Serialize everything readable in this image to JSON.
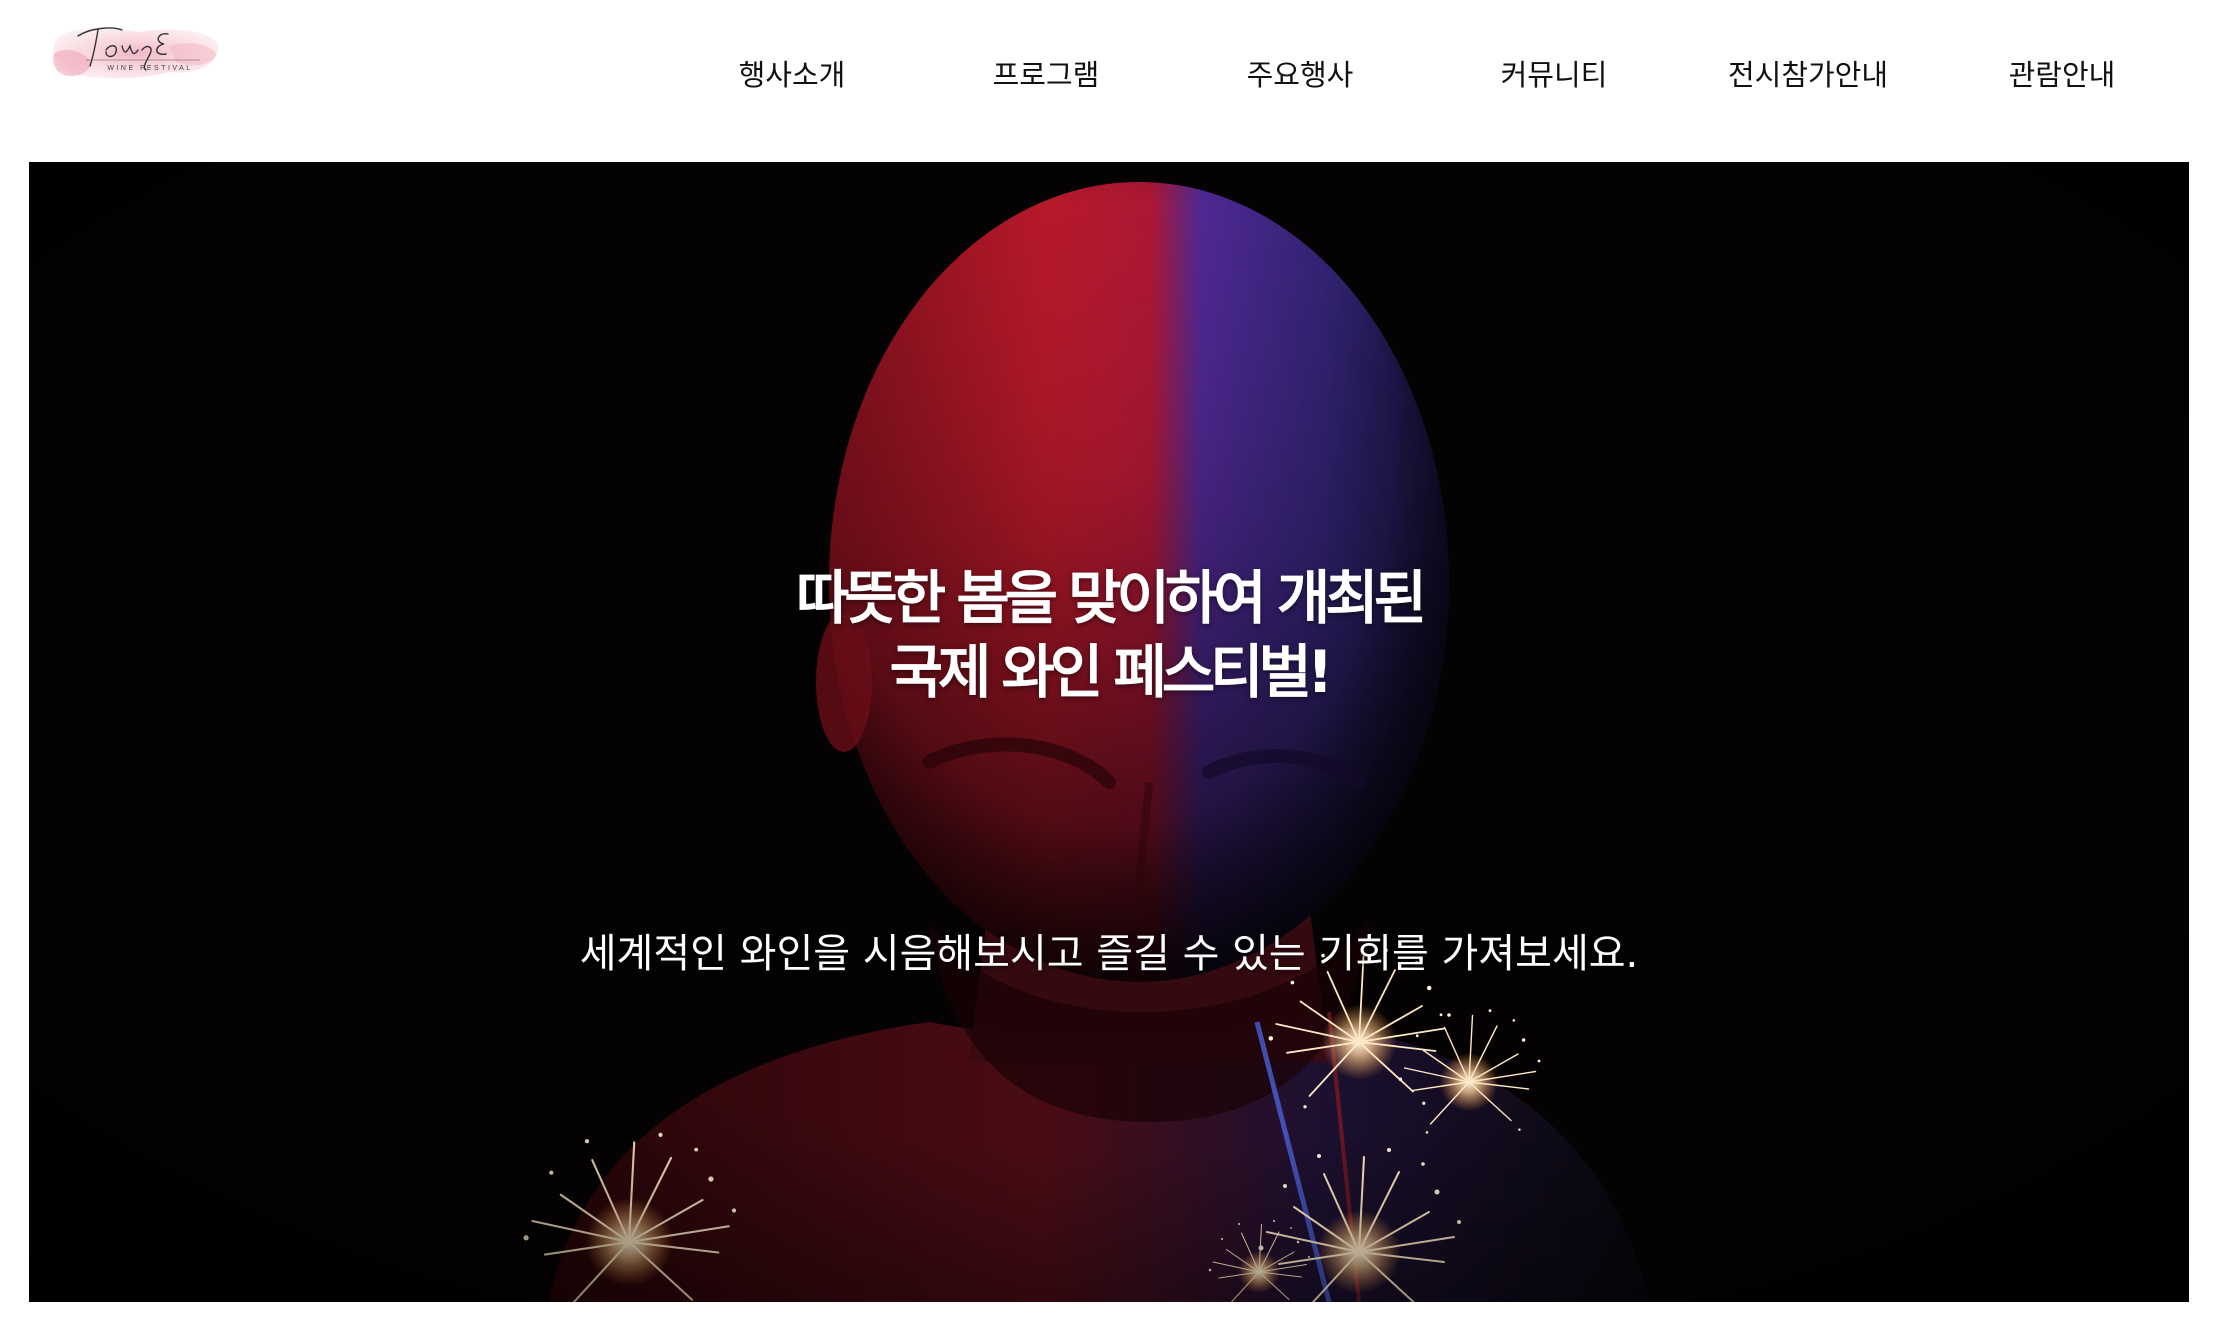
{
  "logo": {
    "script_text": "Tong E",
    "sub_text": "WINE FESTIVAL",
    "accent_color": "#f0b8c4"
  },
  "nav": {
    "items": [
      {
        "label": "행사소개"
      },
      {
        "label": "프로그램"
      },
      {
        "label": "주요행사"
      },
      {
        "label": "커뮤니티"
      },
      {
        "label": "전시참가안내"
      },
      {
        "label": "관람안내"
      }
    ]
  },
  "hero": {
    "headline_line1": "따뜻한 봄을 맞이하여 개최된",
    "headline_line2": "국제 와인 페스티벌!",
    "subline": "세계적인 와인을 시음해보시고 즐길 수 있는 기회를 가져보세요.",
    "background_color": "#050203",
    "light_red": "#d8182c",
    "light_blue": "#4a37c8"
  }
}
